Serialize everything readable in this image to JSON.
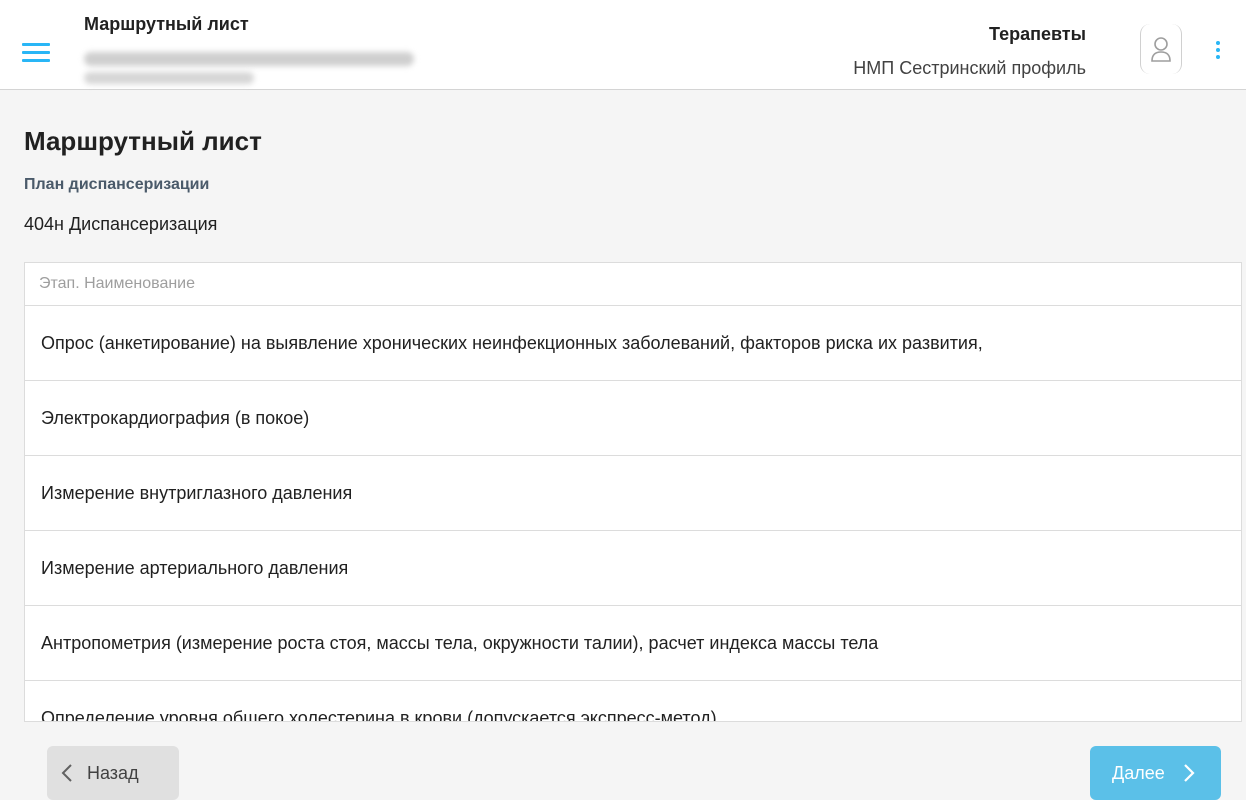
{
  "header": {
    "title": "Маршрутный лист",
    "role": "Терапевты",
    "profile": "НМП Сестринский профиль",
    "menu_icon": "hamburger-menu-icon",
    "avatar_icon": "user-avatar-icon",
    "more_icon": "more-vertical-icon",
    "accent_color": "#29b6f6"
  },
  "main": {
    "title": "Маршрутный лист",
    "plan_label": "План диспансеризации",
    "plan_value": "404н Диспансеризация"
  },
  "table": {
    "header": "Этап. Наименование",
    "rows": [
      "Опрос (анкетирование) на выявление хронических неинфекционных заболеваний, факторов риска их развития,",
      "Электрокардиография (в покое)",
      "Измерение внутриглазного давления",
      "Измерение артериального давления",
      "Антропометрия (измерение роста стоя, массы тела, окружности талии), расчет индекса массы тела",
      "Определение уровня общего холестерина в крови (допускается экспресс-метод)"
    ]
  },
  "footer": {
    "back_label": "Назад",
    "next_label": "Далее",
    "next_color": "#5bc0e8"
  }
}
